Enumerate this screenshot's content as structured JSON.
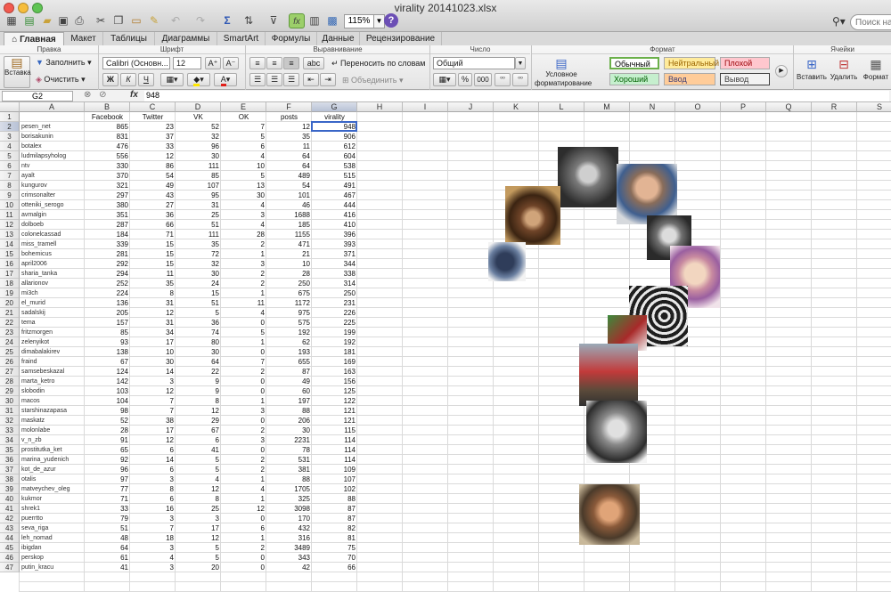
{
  "window": {
    "title": "virality 20141023.xlsx"
  },
  "toolbar": {
    "zoom": "115%",
    "help": "?",
    "search_placeholder": "Поиск на"
  },
  "ribbon_tabs": [
    "Главная",
    "Макет",
    "Таблицы",
    "Диаграммы",
    "SmartArt",
    "Формулы",
    "Данные",
    "Рецензирование"
  ],
  "ribbon": {
    "groups": {
      "clipboard": "Правка",
      "font": "Шрифт",
      "alignment": "Выравнивание",
      "number": "Число",
      "format": "Формат",
      "cells": "Ячейки"
    },
    "paste_label": "Вставка",
    "fill_label": "Заполнить",
    "clear_label": "Очистить",
    "font_name": "Calibri (Основн...",
    "font_size": "12",
    "bold": "Ж",
    "italic": "К",
    "underline": "Ч",
    "wrap_label": "Переносить по словам",
    "merge_label": "Объединить",
    "abc_label": "abc",
    "number_format": "Общий",
    "percent": "%",
    "thousands": "000",
    "cond_format_line1": "Условное",
    "cond_format_line2": "форматирование",
    "styles": {
      "normal": "Обычный",
      "neutral": "Нейтральный",
      "bad": "Плохой",
      "good": "Хороший",
      "input": "Ввод",
      "output": "Вывод"
    },
    "insert_label": "Вставить",
    "delete_label": "Удалить",
    "format_label": "Формат"
  },
  "formula_bar": {
    "cell_ref": "G2",
    "fx": "fx",
    "value": "948"
  },
  "grid": {
    "columns": [
      "A",
      "B",
      "C",
      "D",
      "E",
      "F",
      "G",
      "H",
      "I",
      "J",
      "K",
      "L",
      "M",
      "N",
      "O",
      "P",
      "Q",
      "R",
      "S"
    ],
    "headers": [
      "Facebook",
      "Twitter",
      "VK",
      "OK",
      "posts",
      "virality"
    ],
    "rows": [
      [
        "pesen_net",
        865,
        23,
        52,
        7,
        12,
        948
      ],
      [
        "borisakunin",
        831,
        37,
        32,
        5,
        35,
        906
      ],
      [
        "botalex",
        476,
        33,
        96,
        6,
        11,
        612
      ],
      [
        "ludmilapsyholog",
        556,
        12,
        30,
        4,
        64,
        604
      ],
      [
        "ntv",
        330,
        86,
        111,
        10,
        64,
        538
      ],
      [
        "ayalt",
        370,
        54,
        85,
        5,
        489,
        515
      ],
      [
        "kungurov",
        321,
        49,
        107,
        13,
        54,
        491
      ],
      [
        "crimsonalter",
        297,
        43,
        95,
        30,
        101,
        467
      ],
      [
        "otteniki_serogo",
        380,
        27,
        31,
        4,
        46,
        444
      ],
      [
        "avmalgin",
        351,
        36,
        25,
        3,
        1688,
        416
      ],
      [
        "dolboeb",
        287,
        66,
        51,
        4,
        185,
        410
      ],
      [
        "colonelcassad",
        184,
        71,
        111,
        28,
        1155,
        396
      ],
      [
        "miss_tramell",
        339,
        15,
        35,
        2,
        471,
        393
      ],
      [
        "bohemicus",
        281,
        15,
        72,
        1,
        21,
        371
      ],
      [
        "april2006",
        292,
        15,
        32,
        3,
        10,
        344
      ],
      [
        "sharia_tanka",
        294,
        11,
        30,
        2,
        28,
        338
      ],
      [
        "allarionov",
        252,
        35,
        24,
        2,
        250,
        314
      ],
      [
        "mi3ch",
        224,
        8,
        15,
        1,
        675,
        250
      ],
      [
        "el_murid",
        136,
        31,
        51,
        11,
        1172,
        231
      ],
      [
        "sadalskij",
        205,
        12,
        5,
        4,
        975,
        226
      ],
      [
        "tema",
        157,
        31,
        36,
        0,
        575,
        225
      ],
      [
        "fritzmorgen",
        85,
        34,
        74,
        5,
        192,
        199
      ],
      [
        "zelenyikot",
        93,
        17,
        80,
        1,
        62,
        192
      ],
      [
        "dimabalakirev",
        138,
        10,
        30,
        0,
        193,
        181
      ],
      [
        "fraind",
        67,
        30,
        64,
        7,
        655,
        169
      ],
      [
        "samsebeskazal",
        124,
        14,
        22,
        2,
        87,
        163
      ],
      [
        "marta_ketro",
        142,
        3,
        9,
        0,
        49,
        156
      ],
      [
        "slobodin",
        103,
        12,
        9,
        0,
        60,
        125
      ],
      [
        "macos",
        104,
        7,
        8,
        1,
        197,
        122
      ],
      [
        "starshinazapasa",
        98,
        7,
        12,
        3,
        88,
        121
      ],
      [
        "maskatz",
        52,
        38,
        29,
        0,
        206,
        121
      ],
      [
        "molonlabe",
        28,
        17,
        67,
        2,
        30,
        115
      ],
      [
        "v_n_zb",
        91,
        12,
        6,
        3,
        2231,
        114
      ],
      [
        "prostitutka_ket",
        65,
        6,
        41,
        0,
        78,
        114
      ],
      [
        "marina_yudenich",
        92,
        14,
        5,
        2,
        531,
        114
      ],
      [
        "kot_de_azur",
        96,
        6,
        5,
        2,
        381,
        109
      ],
      [
        "otalis",
        97,
        3,
        4,
        1,
        88,
        107
      ],
      [
        "matveychev_oleg",
        77,
        8,
        12,
        4,
        1705,
        102
      ],
      [
        "kukmor",
        71,
        6,
        8,
        1,
        325,
        88
      ],
      [
        "shrek1",
        33,
        16,
        25,
        12,
        3098,
        87
      ],
      [
        "puerrtto",
        79,
        3,
        3,
        0,
        170,
        87
      ],
      [
        "seva_riga",
        51,
        7,
        17,
        6,
        432,
        82
      ],
      [
        "leh_nomad",
        48,
        18,
        12,
        1,
        316,
        81
      ],
      [
        "ibigdan",
        64,
        3,
        5,
        2,
        3489,
        75
      ],
      [
        "perskop",
        61,
        4,
        5,
        0,
        343,
        70
      ],
      [
        "putin_kracu",
        41,
        3,
        20,
        0,
        42,
        66
      ]
    ]
  },
  "colors": {
    "ribbon_active_tab": "#f4f4f4",
    "selection_border": "#3a66c7",
    "style_good": "#c6efce",
    "style_neutral": "#ffeb9c",
    "style_bad": "#ffc7ce",
    "style_input": "#ffcc99"
  }
}
